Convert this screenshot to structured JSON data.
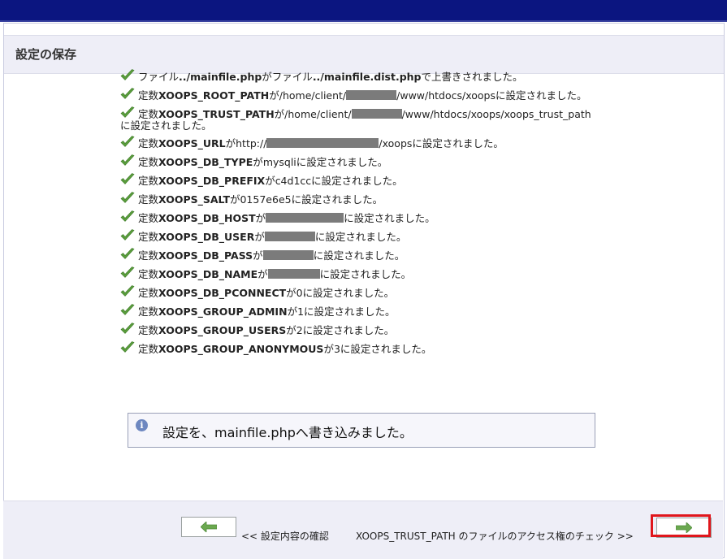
{
  "header": {
    "title": "設定の保存"
  },
  "messages": [
    {
      "parts": [
        "ファイル",
        ".."
      ],
      "bold": "/mainfile.php",
      "mid": "がファイル",
      "bold2": "../mainfile.dist.php",
      "tail": "で上書きされました。"
    },
    {
      "prefix": "定数",
      "name": "XOOPS_ROOT_PATH",
      "text1": "が/home/client/",
      "text2": "/www/htdocs/xoopsに設定されました。"
    },
    {
      "prefix": "定数",
      "name": "XOOPS_TRUST_PATH",
      "text1": "が/home/client/",
      "text2": "/www/htdocs/xoops/xoops_trust_path",
      "line2": "に設定されました。"
    },
    {
      "prefix": "定数",
      "name": "XOOPS_URL",
      "text1": "がhttp://",
      "text2": "/xoopsに設定されました。"
    },
    {
      "prefix": "定数",
      "name": "XOOPS_DB_TYPE",
      "text1": "がmysqliに設定されました。"
    },
    {
      "prefix": "定数",
      "name": "XOOPS_DB_PREFIX",
      "text1": "がc4d1ccに設定されました。"
    },
    {
      "prefix": "定数",
      "name": "XOOPS_SALT",
      "text1": "が0157e6e5に設定されました。"
    },
    {
      "prefix": "定数",
      "name": "XOOPS_DB_HOST",
      "text1": "が",
      "text2": "に設定されました。"
    },
    {
      "prefix": "定数",
      "name": "XOOPS_DB_USER",
      "text1": "が",
      "text2": "に設定されました。"
    },
    {
      "prefix": "定数",
      "name": "XOOPS_DB_PASS",
      "text1": "が",
      "text2": "に設定されました。"
    },
    {
      "prefix": "定数",
      "name": "XOOPS_DB_NAME",
      "text1": "が",
      "text2": "に設定されました。"
    },
    {
      "prefix": "定数",
      "name": "XOOPS_DB_PCONNECT",
      "text1": "が0に設定されました。"
    },
    {
      "prefix": "定数",
      "name": "XOOPS_GROUP_ADMIN",
      "text1": "が1に設定されました。"
    },
    {
      "prefix": "定数",
      "name": "XOOPS_GROUP_USERS",
      "text1": "が2に設定されました。"
    },
    {
      "prefix": "定数",
      "name": "XOOPS_GROUP_ANONYMOUS",
      "text1": "が3に設定されました。"
    }
  ],
  "info": {
    "text": "設定を、mainfile.phpへ書き込みました。"
  },
  "footer": {
    "back_label": "<< 設定内容の確認",
    "next_label": "XOOPS_TRUST_PATH のファイルのアクセス権のチェック >>"
  },
  "icons": {
    "check": "check-icon",
    "info": "info-icon",
    "arrow_left": "arrow-left-icon",
    "arrow_right": "arrow-right-icon"
  },
  "colors": {
    "topbar": "#0b1580",
    "check": "#5a9e3c",
    "arrow": "#6aa84f",
    "highlight": "#e0161c"
  }
}
